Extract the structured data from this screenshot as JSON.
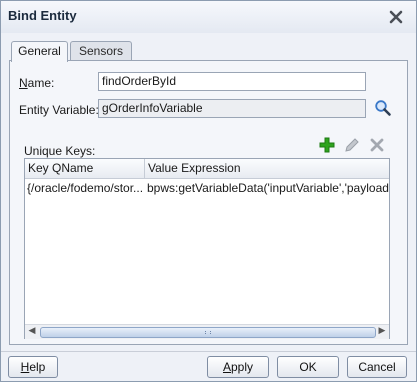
{
  "window": {
    "title": "Bind Entity"
  },
  "tabs": [
    {
      "label": "General",
      "active": true
    },
    {
      "label": "Sensors",
      "active": false
    }
  ],
  "form": {
    "name": {
      "label_mnemonic": "N",
      "label_rest": "ame:",
      "value": "findOrderById"
    },
    "entity_variable": {
      "label": "Entity Variable:",
      "value": "gOrderInfoVariable"
    }
  },
  "unique_keys": {
    "label": "Unique Keys:",
    "columns": [
      "Key QName",
      "Value Expression"
    ],
    "rows": [
      [
        "{/oracle/fodemo/stor...",
        "bpws:getVariableData('inputVariable','payload','/..."
      ]
    ]
  },
  "buttons": {
    "help_mnemonic": "H",
    "help_rest": "elp",
    "apply_mnemonic": "A",
    "apply_rest": "pply",
    "ok": "OK",
    "cancel": "Cancel"
  },
  "icons": {
    "close": "close-icon",
    "search": "search-icon",
    "add": "add-icon",
    "edit": "edit-icon",
    "delete": "delete-icon"
  },
  "colors": {
    "add_green": "#2ea31e",
    "disabled_gray": "#9aa0a8",
    "search_blue": "#3a78c8"
  }
}
